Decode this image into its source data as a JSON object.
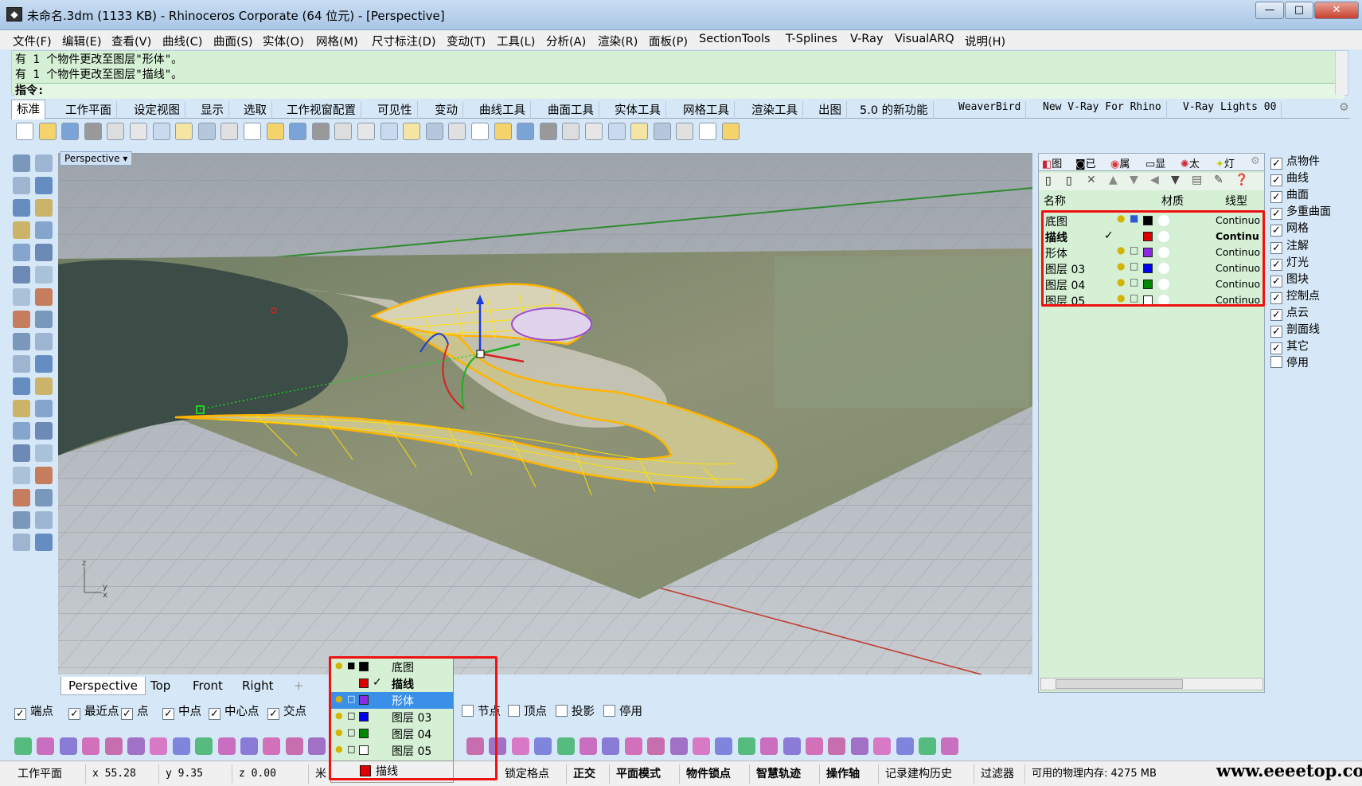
{
  "title": "未命名.3dm (1133 KB) - Rhinoceros Corporate (64 位元) - [Perspective]",
  "window_buttons": [
    "—",
    "□",
    "✕"
  ],
  "menu": [
    "文件(F)",
    "编辑(E)",
    "查看(V)",
    "曲线(C)",
    "曲面(S)",
    "实体(O)",
    "网格(M)",
    "尺寸标注(D)",
    "变动(T)",
    "工具(L)",
    "分析(A)",
    "渲染(R)",
    "面板(P)",
    "SectionTools",
    "T-Splines",
    "V-Ray",
    "VisualARQ",
    "说明(H)"
  ],
  "command": {
    "history": [
      "有 1 个物件更改至图层\"形体\"。",
      "有 1 个物件更改至图层\"描线\"。"
    ],
    "prompt": "指令:"
  },
  "toolbar_tabs": [
    "标准",
    "工作平面",
    "设定视图",
    "显示",
    "选取",
    "工作视窗配置",
    "可见性",
    "变动",
    "曲线工具",
    "曲面工具",
    "实体工具",
    "网格工具",
    "渲染工具",
    "出图",
    "5.0 的新功能",
    "WeaverBird",
    "New V-Ray For Rhino",
    "V-Ray Lights 00"
  ],
  "toolbar_icons": [
    "new-icon",
    "open-icon",
    "save-icon",
    "print-icon",
    "import-icon",
    "cut-icon",
    "copy-icon",
    "paste-icon",
    "undo-icon",
    "pan-icon",
    "move-view-icon",
    "zoom-icon",
    "zoom-window-icon",
    "zoom-extents-icon",
    "zoom-selected-icon",
    "rotate-view-icon",
    "four-views-icon",
    "car-icon",
    "plane-icon",
    "circle-icon",
    "snap-icon",
    "light-icon",
    "lock-icon",
    "layer-icon",
    "color-wheel-icon",
    "material-icon",
    "shade-icon",
    "render-icon",
    "flag-icon",
    "gear-icon",
    "options-icon",
    "help-icon"
  ],
  "viewport": {
    "label": "Perspective",
    "tabs": [
      "Perspective",
      "Top",
      "Front",
      "Right",
      "+"
    ],
    "axis_labels": {
      "z": "z",
      "y": "y",
      "x": "x"
    }
  },
  "layer_panel": {
    "tabs": [
      "图",
      "已",
      "属",
      "显",
      "太",
      "灯"
    ],
    "headers": {
      "name": "名称",
      "material": "材质",
      "linetype": "线型"
    },
    "layers": [
      {
        "name": "底图",
        "current": false,
        "locked": true,
        "color": "#000000",
        "linetype": "Continuo"
      },
      {
        "name": "描线",
        "current": true,
        "locked": false,
        "color": "#dd0000",
        "linetype": "Continu"
      },
      {
        "name": "形体",
        "current": false,
        "locked": false,
        "color": "#8a2be2",
        "linetype": "Continuo"
      },
      {
        "name": "图层 03",
        "current": false,
        "locked": false,
        "color": "#0000ee",
        "linetype": "Continuo"
      },
      {
        "name": "图层 04",
        "current": false,
        "locked": false,
        "color": "#008800",
        "linetype": "Continuo"
      },
      {
        "name": "图层 05",
        "current": false,
        "locked": false,
        "color": "#ffffff",
        "linetype": "Continuo"
      }
    ],
    "checkmark": "✓"
  },
  "select_filter": [
    {
      "label": "点物件",
      "checked": true
    },
    {
      "label": "曲线",
      "checked": true
    },
    {
      "label": "曲面",
      "checked": true
    },
    {
      "label": "多重曲面",
      "checked": true
    },
    {
      "label": "网格",
      "checked": true
    },
    {
      "label": "注解",
      "checked": true
    },
    {
      "label": "灯光",
      "checked": true
    },
    {
      "label": "图块",
      "checked": true
    },
    {
      "label": "控制点",
      "checked": true
    },
    {
      "label": "点云",
      "checked": true
    },
    {
      "label": "剖面线",
      "checked": true
    },
    {
      "label": "其它",
      "checked": true
    },
    {
      "label": "停用",
      "checked": false
    }
  ],
  "osnaps": [
    {
      "label": "端点",
      "checked": true
    },
    {
      "label": "最近点",
      "checked": true
    },
    {
      "label": "点",
      "checked": true
    },
    {
      "label": "中点",
      "checked": true
    },
    {
      "label": "中心点",
      "checked": true
    },
    {
      "label": "交点",
      "checked": true
    },
    {
      "label": "节点",
      "checked": false
    },
    {
      "label": "顶点",
      "checked": false
    },
    {
      "label": "投影",
      "checked": false
    },
    {
      "label": "停用",
      "checked": false
    }
  ],
  "layer_dropdown": {
    "items": [
      {
        "name": "底图",
        "color": "#000000"
      },
      {
        "name": "描线",
        "color": "#dd0000",
        "current": true
      },
      {
        "name": "形体",
        "color": "#8a2be2",
        "selected": true
      },
      {
        "name": "图层 03",
        "color": "#0000ee"
      },
      {
        "name": "图层 04",
        "color": "#008800"
      },
      {
        "name": "图层 05",
        "color": "#ffffff"
      }
    ],
    "current_layer": "描线"
  },
  "status": {
    "cplane": "工作平面",
    "x": "x 55.28",
    "y": "y 9.35",
    "z": "z 0.00",
    "unit": "米",
    "grid_snap": "锁定格点",
    "ortho": "正交",
    "planar": "平面模式",
    "osnap": "物件锁点",
    "smarttrack": "智慧轨迹",
    "gumball": "操作轴",
    "history": "记录建构历史",
    "filter": "过滤器",
    "memory": "可用的物理内存: 4275 MB"
  },
  "watermark": "www.eeeetop.com",
  "colors": {
    "panel_green": "#d5f0d5",
    "highlight_red": "#e11111",
    "selection_blue": "#3a8fe8"
  }
}
